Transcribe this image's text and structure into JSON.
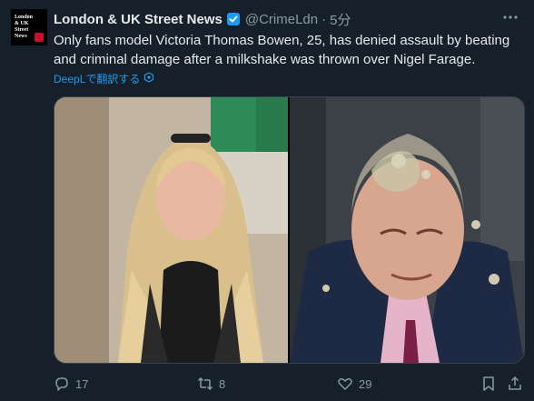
{
  "tweet": {
    "display_name": "London & UK Street News",
    "handle": "@CrimeLdn",
    "separator": "·",
    "time": "5分",
    "text": "Only fans model Victoria Thomas Bowen, 25, has denied assault by beating and criminal damage after a milkshake was thrown over Nigel Farage.",
    "translate_label": "DeepLで翻訳する",
    "avatar_text": "London & UK Street News",
    "verified_color": "#1d9bf0"
  },
  "media": {
    "left_photo_icon": "photo-woman",
    "right_photo_icon": "photo-man-milkshake"
  },
  "actions": {
    "reply_count": "17",
    "retweet_count": "8",
    "like_count": "29"
  },
  "colors": {
    "background": "#15202b",
    "text": "#e7e9ea",
    "muted": "#8b98a5",
    "link": "#1d9bf0"
  }
}
